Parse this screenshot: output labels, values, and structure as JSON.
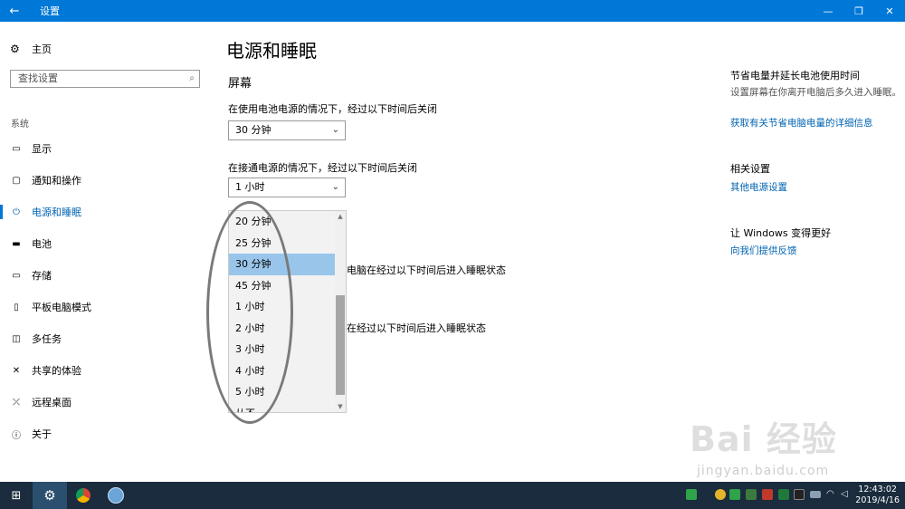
{
  "window": {
    "title": "设置",
    "back_icon": "←",
    "min_icon": "—",
    "max_icon": "❐",
    "close_icon": "✕"
  },
  "sidebar": {
    "home": {
      "icon": "⚙",
      "label": "主页"
    },
    "search_placeholder": "查找设置",
    "section": "系统",
    "items": [
      {
        "icon": "▭",
        "label": "显示"
      },
      {
        "icon": "▢",
        "label": "通知和操作"
      },
      {
        "icon": "⏻",
        "label": "电源和睡眠",
        "active": true
      },
      {
        "icon": "▬",
        "label": "电池"
      },
      {
        "icon": "▭",
        "label": "存储"
      },
      {
        "icon": "▯",
        "label": "平板电脑模式"
      },
      {
        "icon": "◫",
        "label": "多任务"
      },
      {
        "icon": "✕",
        "label": "共享的体验"
      },
      {
        "icon": "⤫",
        "label": "远程桌面"
      },
      {
        "icon": "ⓘ",
        "label": "关于"
      }
    ]
  },
  "main": {
    "title": "电源和睡眠",
    "screen_heading": "屏幕",
    "battery_label": "在使用电池电源的情况下，经过以下时间后关闭",
    "battery_value": "30 分钟",
    "plugged_label": "在接通电源的情况下，经过以下时间后关闭",
    "plugged_value": "1 小时",
    "dropdown_options": [
      "20 分钟",
      "25 分钟",
      "30 分钟",
      "45 分钟",
      "1 小时",
      "2 小时",
      "3 小时",
      "4 小时",
      "5 小时",
      "从不"
    ],
    "dropdown_selected_index": 2,
    "partial_sleep_battery": "电脑在经过以下时间后进入睡眠状态",
    "partial_sleep_plugged": "在经过以下时间后进入睡眠状态"
  },
  "right": {
    "save_heading": "节省电量并延长电池使用时间",
    "save_text": "设置屏幕在你离开电脑后多久进入睡眠。",
    "save_link": "获取有关节省电脑电量的详细信息",
    "related_heading": "相关设置",
    "related_link": "其他电源设置",
    "better_heading": "让 Windows 变得更好",
    "better_link": "向我们提供反馈"
  },
  "taskbar": {
    "clock_time": "12:43:02",
    "clock_date": "2019/4/16"
  },
  "watermark": {
    "text": "Bai 经验",
    "url": "jingyan.baidu.com"
  },
  "colors": {
    "accent": "#0078d7",
    "link": "#0063b1",
    "selection": "#99c5ea",
    "taskbar": "#1a2c3d"
  }
}
